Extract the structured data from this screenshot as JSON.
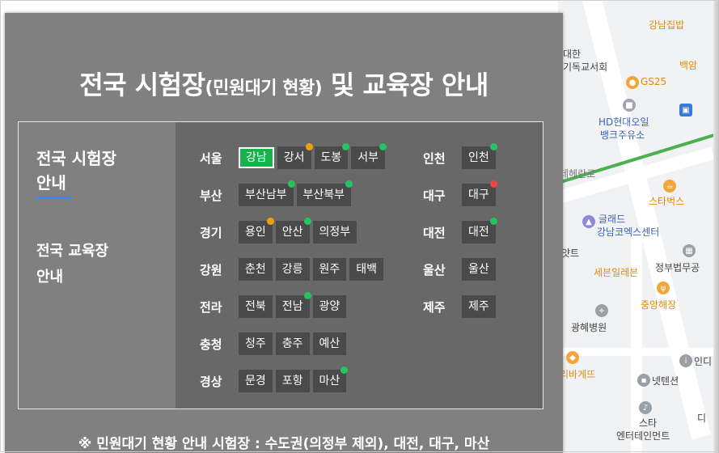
{
  "title": {
    "main_a": "전국 시험장",
    "main_small": "(민원대기 현황)",
    "main_b": " 및 교육장 안내"
  },
  "nav": {
    "exam_line1": "전국 시험장",
    "exam_line2": "안내",
    "edu_line1": "전국 교육장",
    "edu_line2": "안내"
  },
  "left_regions": [
    {
      "name": "서울",
      "sites": [
        {
          "label": "강남",
          "status": "active"
        },
        {
          "label": "강서",
          "status": "orange"
        },
        {
          "label": "도봉",
          "status": "green"
        },
        {
          "label": "서부",
          "status": "green"
        }
      ]
    },
    {
      "name": "부산",
      "sites": [
        {
          "label": "부산남부",
          "status": "green"
        },
        {
          "label": "부산북부",
          "status": "green"
        }
      ]
    },
    {
      "name": "경기",
      "sites": [
        {
          "label": "용인",
          "status": "orange"
        },
        {
          "label": "안산",
          "status": "green"
        },
        {
          "label": "의정부",
          "status": "none"
        }
      ]
    },
    {
      "name": "강원",
      "sites": [
        {
          "label": "춘천",
          "status": "none"
        },
        {
          "label": "강릉",
          "status": "none"
        },
        {
          "label": "원주",
          "status": "none"
        },
        {
          "label": "태백",
          "status": "none"
        }
      ]
    },
    {
      "name": "전라",
      "sites": [
        {
          "label": "전북",
          "status": "none"
        },
        {
          "label": "전남",
          "status": "green"
        },
        {
          "label": "광양",
          "status": "none"
        }
      ]
    },
    {
      "name": "충청",
      "sites": [
        {
          "label": "청주",
          "status": "none"
        },
        {
          "label": "충주",
          "status": "none"
        },
        {
          "label": "예산",
          "status": "none"
        }
      ]
    },
    {
      "name": "경상",
      "sites": [
        {
          "label": "문경",
          "status": "none"
        },
        {
          "label": "포항",
          "status": "none"
        },
        {
          "label": "마산",
          "status": "green"
        }
      ]
    }
  ],
  "right_regions": [
    {
      "name": "인천",
      "sites": [
        {
          "label": "인천",
          "status": "green"
        }
      ]
    },
    {
      "name": "대구",
      "sites": [
        {
          "label": "대구",
          "status": "red"
        }
      ]
    },
    {
      "name": "대전",
      "sites": [
        {
          "label": "대전",
          "status": "green"
        }
      ]
    },
    {
      "name": "울산",
      "sites": [
        {
          "label": "울산",
          "status": "none"
        }
      ]
    },
    {
      "name": "제주",
      "sites": [
        {
          "label": "제주",
          "status": "none"
        }
      ]
    }
  ],
  "footer": "※ 민원대기 현황 안내 시험장 : 수도권(의정부 제외), 대전, 대구, 마산",
  "map_labels": [
    "강남집밥",
    "백암",
    "대한",
    "기독교서회",
    "GS25",
    "HD현대오일",
    "뱅크주유소",
    "테헤란로",
    "스타벅스",
    "글래드",
    "강남코엑스센터",
    "얏트",
    "세븐일레븐",
    "정부법무공",
    "중앙해장",
    "광혜병원",
    "인디",
    "리바게뜨",
    "넷텐션",
    "스타",
    "엔터테인먼트",
    "디"
  ],
  "colors": {
    "overlay": "#808080",
    "pane": "#686868",
    "chip": "#4a4a4a",
    "active": "#18b24a",
    "green": "#22c55e",
    "orange": "#f59e0b",
    "red": "#ef4444",
    "nav_underline": "#2f8bff"
  }
}
